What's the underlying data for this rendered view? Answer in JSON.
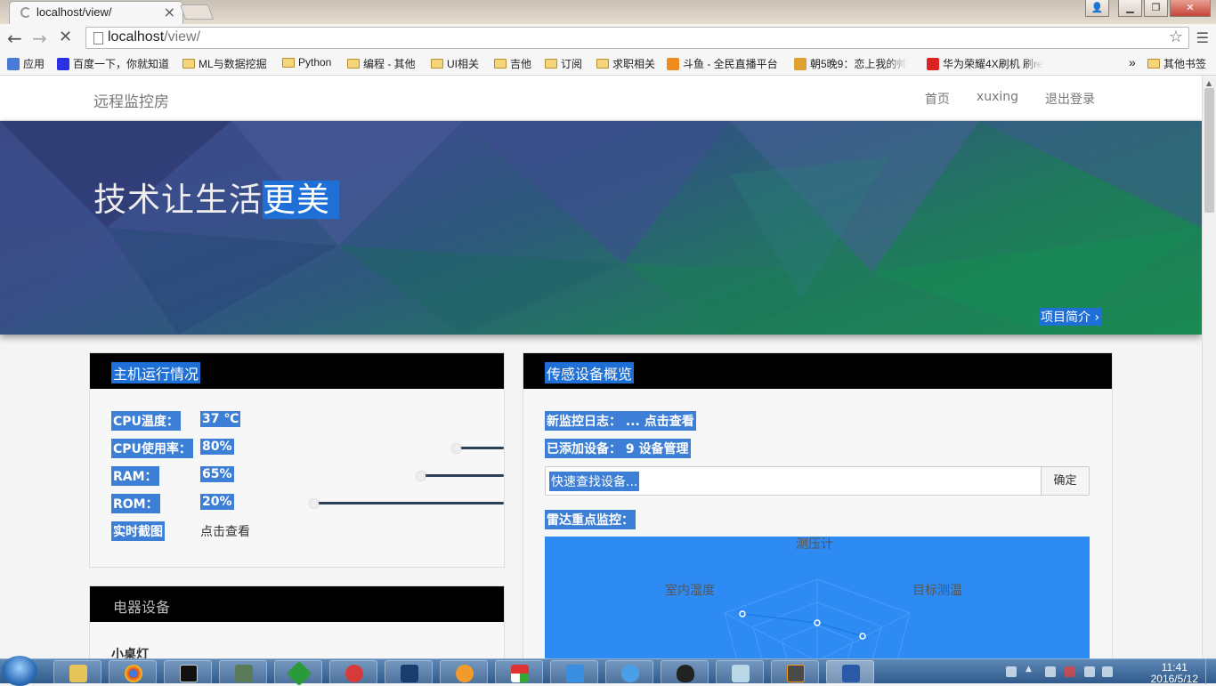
{
  "browser": {
    "tab_title": "localhost/view/",
    "url_host": "localhost",
    "url_path": "/view/",
    "bookmarks": [
      {
        "label": "应用",
        "kind": "apps"
      },
      {
        "label": "百度一下，你就知道",
        "kind": "baidu"
      },
      {
        "label": "ML与数据挖掘",
        "kind": "folder"
      },
      {
        "label": "Python",
        "kind": "folder"
      },
      {
        "label": "编程 - 其他",
        "kind": "folder"
      },
      {
        "label": "UI相关",
        "kind": "folder"
      },
      {
        "label": "吉他",
        "kind": "folder"
      },
      {
        "label": "订阅",
        "kind": "folder"
      },
      {
        "label": "求职相关",
        "kind": "folder"
      },
      {
        "label": "斗鱼 - 全民直播平台",
        "kind": "douyu"
      },
      {
        "label": "朝5晚9：恋上我的帅",
        "kind": "site"
      },
      {
        "label": "华为荣耀4X刷机 刷re",
        "kind": "huawei"
      }
    ],
    "overflow_label": "»",
    "other_bookmarks": "其他书签"
  },
  "site": {
    "brand": "远程监控房",
    "nav": [
      "首页",
      "xuxing",
      "退出登录"
    ],
    "hero_title_a": "技术让生活",
    "hero_title_b": "更美",
    "hero_link": "项目简介"
  },
  "host_panel": {
    "title": "主机运行情况",
    "cpu_temp_label": "CPU温度：",
    "cpu_temp_value": "37 ℃",
    "rows": [
      {
        "label": "CPU使用率：",
        "value": "80%",
        "level": 0.8
      },
      {
        "label": "RAM：",
        "value": "65%",
        "level": 0.65
      },
      {
        "label": "ROM：",
        "value": "20%",
        "level": 0.2
      }
    ],
    "screenshot_label": "实时截图",
    "screenshot_link": "点击查看"
  },
  "appliance_panel": {
    "title": "电器设备",
    "first_item": "小桌灯"
  },
  "sensor_panel": {
    "title": "传感设备概览",
    "log_line": "新监控日志： ... 点击查看",
    "devices_line": "已添加设备： 9 设备管理",
    "search_placeholder": "快速查找设备...",
    "search_button": "确定",
    "radar_title": "雷达重点监控：",
    "radar_axes": [
      "测压计",
      "目标测温",
      "室内湿度"
    ]
  },
  "taskbar": {
    "time": "11:41",
    "date": "2016/5/12"
  },
  "colors": {
    "selection": "#1e6fd6",
    "label_highlight": "#3d7fd6",
    "radar_bg": "#2f8bf4",
    "panel_header": "#000000"
  }
}
